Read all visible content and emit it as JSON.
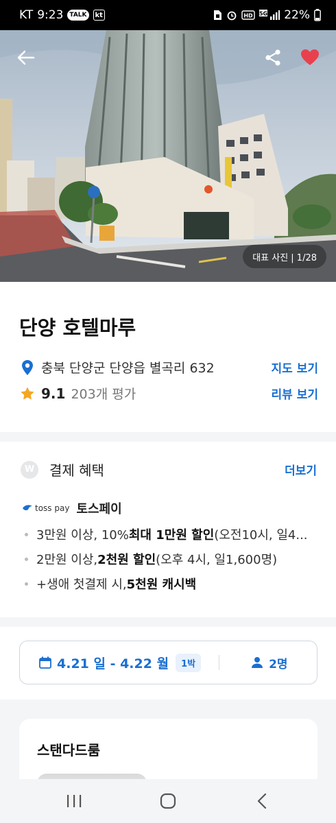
{
  "status_bar": {
    "carrier": "KT",
    "time": "9:23",
    "talk_badge": "TALK",
    "kt_badge": "kt",
    "battery": "22%"
  },
  "hero": {
    "photo_counter": "대표 사진 | 1/28"
  },
  "hotel": {
    "name": "단양 호텔마루",
    "address": "충북 단양군 단양읍 별곡리 632",
    "map_link": "지도 보기",
    "rating": "9.1",
    "review_count": "203개 평가",
    "review_link": "리뷰 보기"
  },
  "payment": {
    "badge": "W",
    "title": "결제 혜택",
    "more_link": "더보기",
    "provider_logo_text": "toss pay",
    "provider_name": "토스페이",
    "benefits": [
      {
        "prefix": "3만원 이상, 10% ",
        "bold": "최대 1만원 할인",
        "suffix": "(오전10시, 일4..."
      },
      {
        "prefix": "2만원 이상, ",
        "bold": "2천원 할인",
        "suffix": " (오후 4시, 일1,600명)"
      },
      {
        "prefix": "+생애 첫결제 시, ",
        "bold": "5천원 캐시백",
        "suffix": ""
      }
    ]
  },
  "booking": {
    "dates": "4.21 일 - 4.22 월",
    "nights": "1박",
    "guests": "2명"
  },
  "room": {
    "title": "스탠다드룸"
  },
  "colors": {
    "accent": "#1a6fd1",
    "heart": "#e8414d",
    "star": "#f5a623"
  }
}
